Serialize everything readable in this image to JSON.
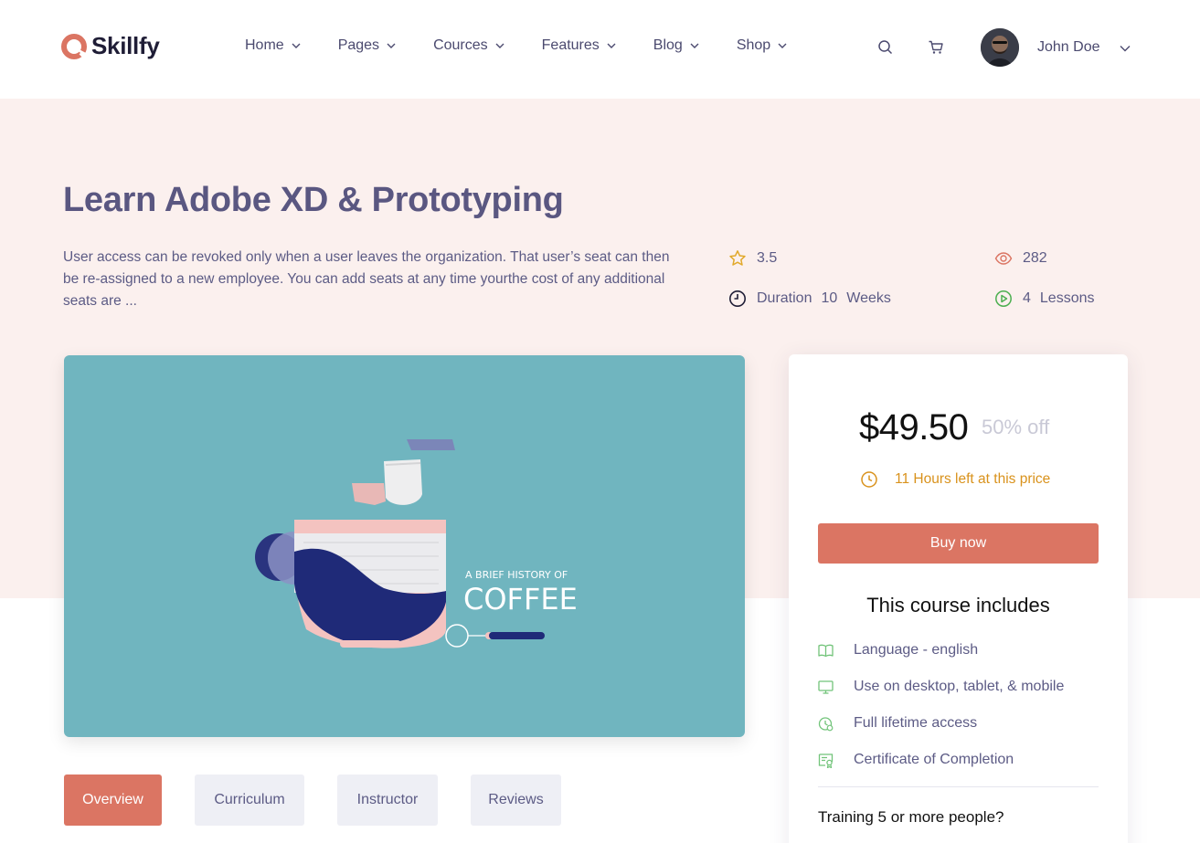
{
  "brand": {
    "name": "Skillfy",
    "accent": "#db7563"
  },
  "nav": {
    "items": [
      {
        "label": "Home"
      },
      {
        "label": "Pages"
      },
      {
        "label": "Cources"
      },
      {
        "label": "Features"
      },
      {
        "label": "Blog"
      },
      {
        "label": "Shop"
      }
    ]
  },
  "header": {
    "search_icon": "search-icon",
    "cart_icon": "cart-icon",
    "user_name": "John Doe"
  },
  "course": {
    "title": "Learn Adobe XD & Prototyping",
    "description": "User access can be revoked only when a user leaves the organization. That user’s seat can then be re-assigned to a new employee. You can add seats at any time yourthe cost of any additional seats are ...",
    "rating": "3.5",
    "views": "282",
    "duration_label": "Duration",
    "duration_value": "10",
    "duration_unit": "Weeks",
    "lessons_value": "4",
    "lessons_label": "Lessons",
    "image_text_line1": "A BRIEF HISTORY OF",
    "image_text_line2": "COFFEE"
  },
  "tabs": [
    {
      "label": "Overview",
      "active": true
    },
    {
      "label": "Curriculum",
      "active": false
    },
    {
      "label": "Instructor",
      "active": false
    },
    {
      "label": "Reviews",
      "active": false
    }
  ],
  "card": {
    "price": "$49.50",
    "discount": "50% off",
    "time_left": "11 Hours left at this price",
    "buy_label": "Buy now",
    "includes_title": "This course includes",
    "includes": [
      {
        "label": "Language - english",
        "icon": "book-icon"
      },
      {
        "label": "Use on desktop, tablet, & mobile",
        "icon": "monitor-icon"
      },
      {
        "label": "Full lifetime access",
        "icon": "lifetime-clock-icon"
      },
      {
        "label": "Certificate of Completion",
        "icon": "certificate-icon"
      }
    ],
    "training_text": "Training 5 or more people?"
  }
}
